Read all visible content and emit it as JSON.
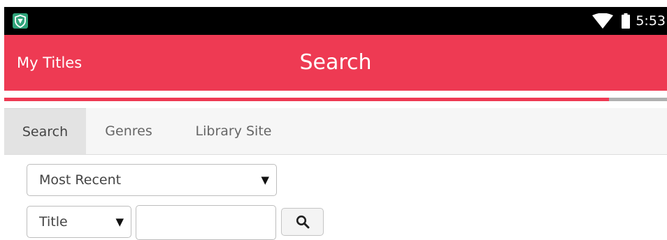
{
  "status_bar": {
    "time": "5:53",
    "icons": [
      "shield-app-icon",
      "wifi-icon",
      "battery-icon"
    ]
  },
  "app_bar": {
    "back_label": "My Titles",
    "title": "Search",
    "background_color": "#ee3a53"
  },
  "progress": {
    "fraction": 0.912,
    "fill_color": "#ee3a53",
    "track_color": "#b0b0b0"
  },
  "tabs": [
    {
      "label": "Search",
      "active": true
    },
    {
      "label": "Genres",
      "active": false
    },
    {
      "label": "Library Site",
      "active": false
    }
  ],
  "search_form": {
    "sort_select": {
      "value": "Most Recent"
    },
    "field_select": {
      "value": "Title"
    },
    "query_input": {
      "value": "",
      "placeholder": ""
    },
    "search_button_icon": "magnifier-icon"
  }
}
